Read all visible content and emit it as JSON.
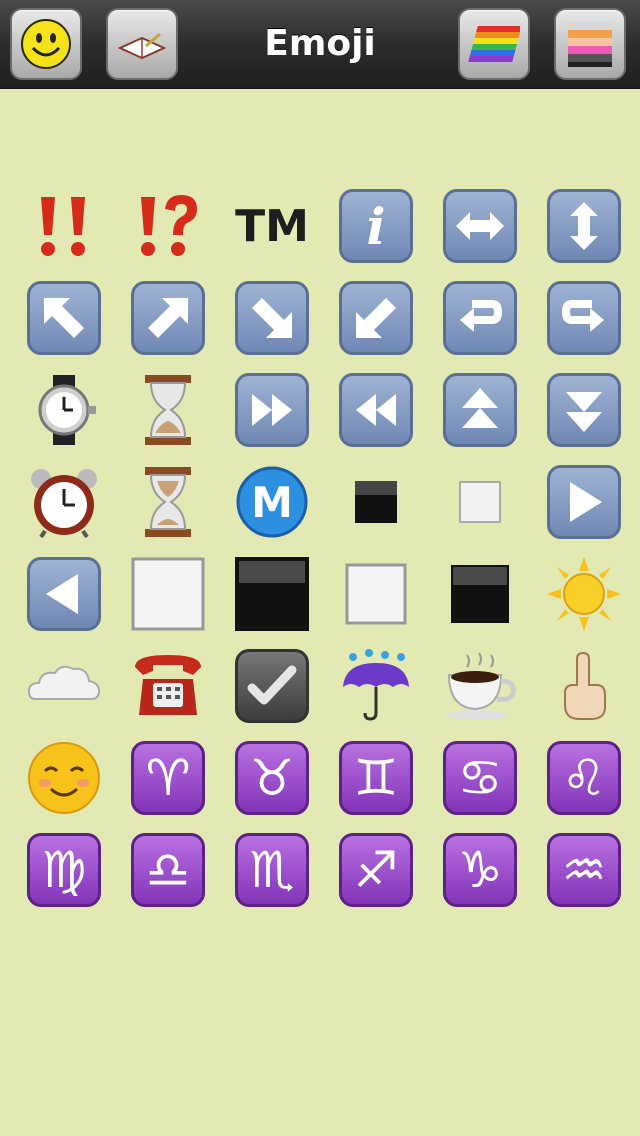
{
  "header": {
    "title": "Emoji",
    "buttons": [
      {
        "icon": "smiley-icon"
      },
      {
        "icon": "book-icon"
      },
      {
        "icon": "rainbow-icon"
      },
      {
        "icon": "color-stripes-icon"
      }
    ]
  },
  "emoji_grid": [
    [
      "double-exclamation-icon",
      "exclamation-question-icon",
      "trademark-icon",
      "information-icon",
      "left-right-arrow-icon",
      "up-down-arrow-icon"
    ],
    [
      "up-left-arrow-icon",
      "up-right-arrow-icon",
      "down-right-arrow-icon",
      "down-left-arrow-icon",
      "return-left-arrow-icon",
      "return-right-arrow-icon"
    ],
    [
      "watch-icon",
      "hourglass-icon",
      "fast-forward-icon",
      "rewind-icon",
      "double-up-arrow-icon",
      "double-down-arrow-icon"
    ],
    [
      "alarm-clock-icon",
      "hourglass-flowing-icon",
      "circled-m-icon",
      "black-small-square-icon",
      "white-small-square-icon",
      "play-button-icon"
    ],
    [
      "reverse-button-icon",
      "white-large-square-icon",
      "black-large-square-icon",
      "white-medium-square-icon",
      "black-medium-square-icon",
      "sun-icon"
    ],
    [
      "cloud-icon",
      "telephone-icon",
      "check-mark-icon",
      "umbrella-rain-icon",
      "hot-beverage-icon",
      "index-pointing-up-icon"
    ],
    [
      "smiling-face-icon",
      "aries-icon",
      "taurus-icon",
      "gemini-icon",
      "cancer-icon",
      "leo-icon"
    ],
    [
      "virgo-icon",
      "libra-icon",
      "scorpio-icon",
      "sagittarius-icon",
      "capricorn-icon",
      "aquarius-icon"
    ]
  ],
  "glyphs": {
    "trademark": "TM",
    "info": "i",
    "metro": "M",
    "aries": "♈",
    "taurus": "♉",
    "gemini": "♊",
    "cancer": "♋",
    "leo": "♌",
    "virgo": "♍",
    "libra": "♎",
    "scorpio": "♏",
    "sagittarius": "♐",
    "capricorn": "♑",
    "aquarius": "♒"
  },
  "colors": {
    "background": "#e2e9b2",
    "topbar": "#2d2d2d",
    "blue_tile": "#7f97c1",
    "purple_tile": "#9a45cc"
  }
}
